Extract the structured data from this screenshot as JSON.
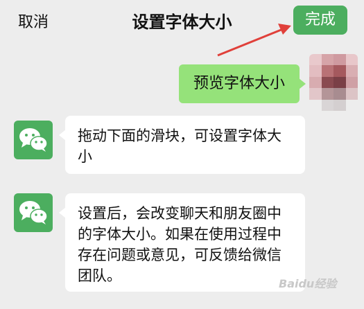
{
  "header": {
    "cancel_label": "取消",
    "title": "设置字体大小",
    "done_label": "完成"
  },
  "preview": {
    "self_message": "预览字体大小"
  },
  "messages": [
    {
      "sender": "wechat",
      "text": "拖动下面的滑块，可设置字体大小"
    },
    {
      "sender": "wechat",
      "text": "设置后，会改变聊天和朋友圈中的字体大小。如果在使用过程中存在问题或意见，可反馈给微信团队。"
    }
  ],
  "watermark": "Baidu经验",
  "colors": {
    "background": "#ededed",
    "done_button": "#4cae5f",
    "self_bubble": "#95e27a",
    "annotation_arrow": "#e0403a"
  },
  "icons": {
    "wechat_avatar": "wechat-logo-icon"
  }
}
